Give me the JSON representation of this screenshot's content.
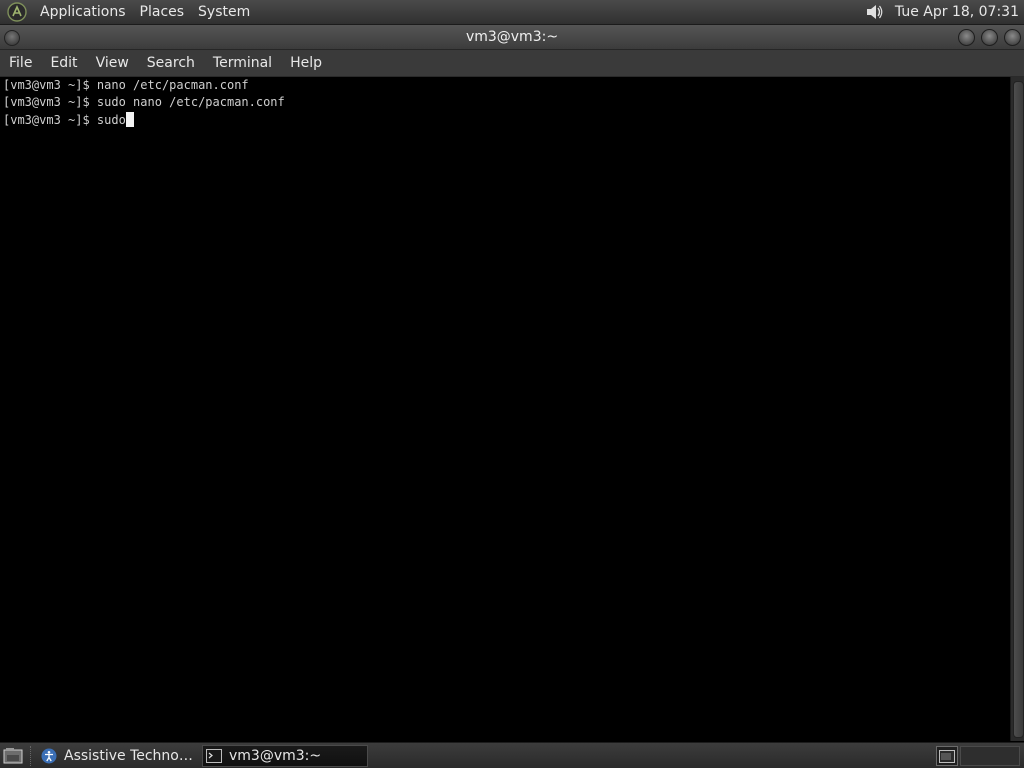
{
  "top_panel": {
    "logo_icon": "arch-linux-logo-icon",
    "menus": [
      "Applications",
      "Places",
      "System"
    ],
    "volume_icon": "speaker-volume-icon",
    "clock": "Tue Apr 18, 07:31"
  },
  "window": {
    "title": "vm3@vm3:~",
    "menu_icon": "window-menu-icon",
    "controls": [
      "minimize-icon",
      "maximize-icon",
      "close-icon"
    ]
  },
  "menubar": {
    "items": [
      "File",
      "Edit",
      "View",
      "Search",
      "Terminal",
      "Help"
    ]
  },
  "terminal": {
    "lines": [
      "[vm3@vm3 ~]$ nano /etc/pacman.conf",
      "[vm3@vm3 ~]$ sudo nano /etc/pacman.conf",
      "[vm3@vm3 ~]$ sudo"
    ],
    "cursor_visible": true
  },
  "bottom_panel": {
    "show_desktop_icon": "show-desktop-icon",
    "tasks": [
      {
        "label": "Assistive Technologi…",
        "icon": "accessibility-icon",
        "active": false
      },
      {
        "label": "vm3@vm3:~",
        "icon": "terminal-icon",
        "active": true
      }
    ],
    "workspace_icon": "workspace-switcher-icon"
  },
  "colors": {
    "panel_bg": "#3a3a3a",
    "terminal_bg": "#000000",
    "terminal_fg": "#cfcfcf",
    "cursor": "#f2f2f2"
  }
}
